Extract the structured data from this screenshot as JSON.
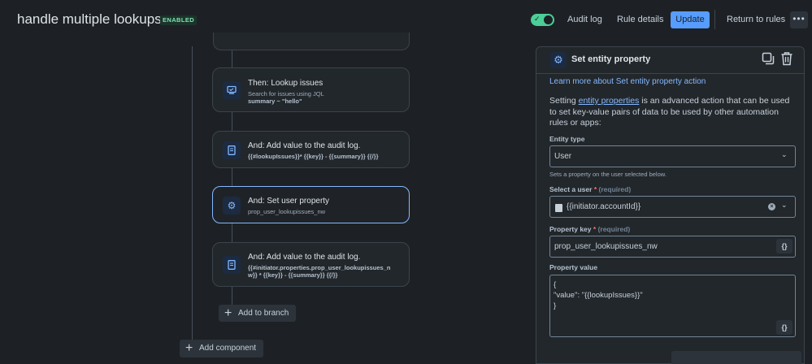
{
  "header": {
    "title": "handle multiple lookups",
    "status_badge": "ENABLED",
    "toggle_check": "✓",
    "audit_log": "Audit log",
    "rule_details": "Rule details",
    "update": "Update",
    "return_to_rules": "Return to rules",
    "more": "•••"
  },
  "flow": {
    "cards": [
      {
        "title": "Then: Lookup issues",
        "sub1": "Search for issues using JQL",
        "sub2": "summary ~ \"hello\"",
        "icon": "lookup-icon"
      },
      {
        "title": "And: Add value to the audit log.",
        "sub1": "{{#lookupIssues}}* {{key}} - {{summary}} {{/}}",
        "icon": "document-icon"
      },
      {
        "title": "And: Set user property",
        "sub1": "prop_user_lookupissues_nw",
        "icon": "gear-icon"
      },
      {
        "title": "And: Add value to the audit log.",
        "sub1": "{{#initiator.properties.prop_user_lookupissues_n",
        "sub2": "w}} * {{key}} - {{summary}} {{/}}",
        "icon": "document-icon"
      }
    ],
    "add_to_branch": "Add to branch",
    "add_component": "Add component",
    "plus": "+"
  },
  "panel": {
    "title": "Set entity property",
    "learn_more": "Learn more about Set entity property action",
    "desc_prefix": "Setting ",
    "desc_link": "entity properties",
    "desc_suffix": " is an advanced action that can be used to set key-value pairs of data to be used by other automation rules or apps:",
    "entity_type": {
      "label": "Entity type",
      "value": "User",
      "hint": "Sets a property on the user selected below."
    },
    "select_user": {
      "label": "Select a user",
      "asterisk": "*",
      "required": "(required)",
      "value": "{{initiator.accountId}}",
      "clear": "×"
    },
    "property_key": {
      "label": "Property key",
      "asterisk": "*",
      "required": "(required)",
      "value": "prop_user_lookupissues_nw"
    },
    "property_value": {
      "label": "Property value",
      "lines": [
        "{",
        "\"value\": \"{{lookupIssues}}\"",
        "}"
      ]
    },
    "code_button": "{}",
    "chevron": "⌄"
  },
  "colors": {
    "accent": "#579dff",
    "toggle_on": "#4bce97",
    "link": "#85b8ff",
    "background": "#1d2125"
  }
}
